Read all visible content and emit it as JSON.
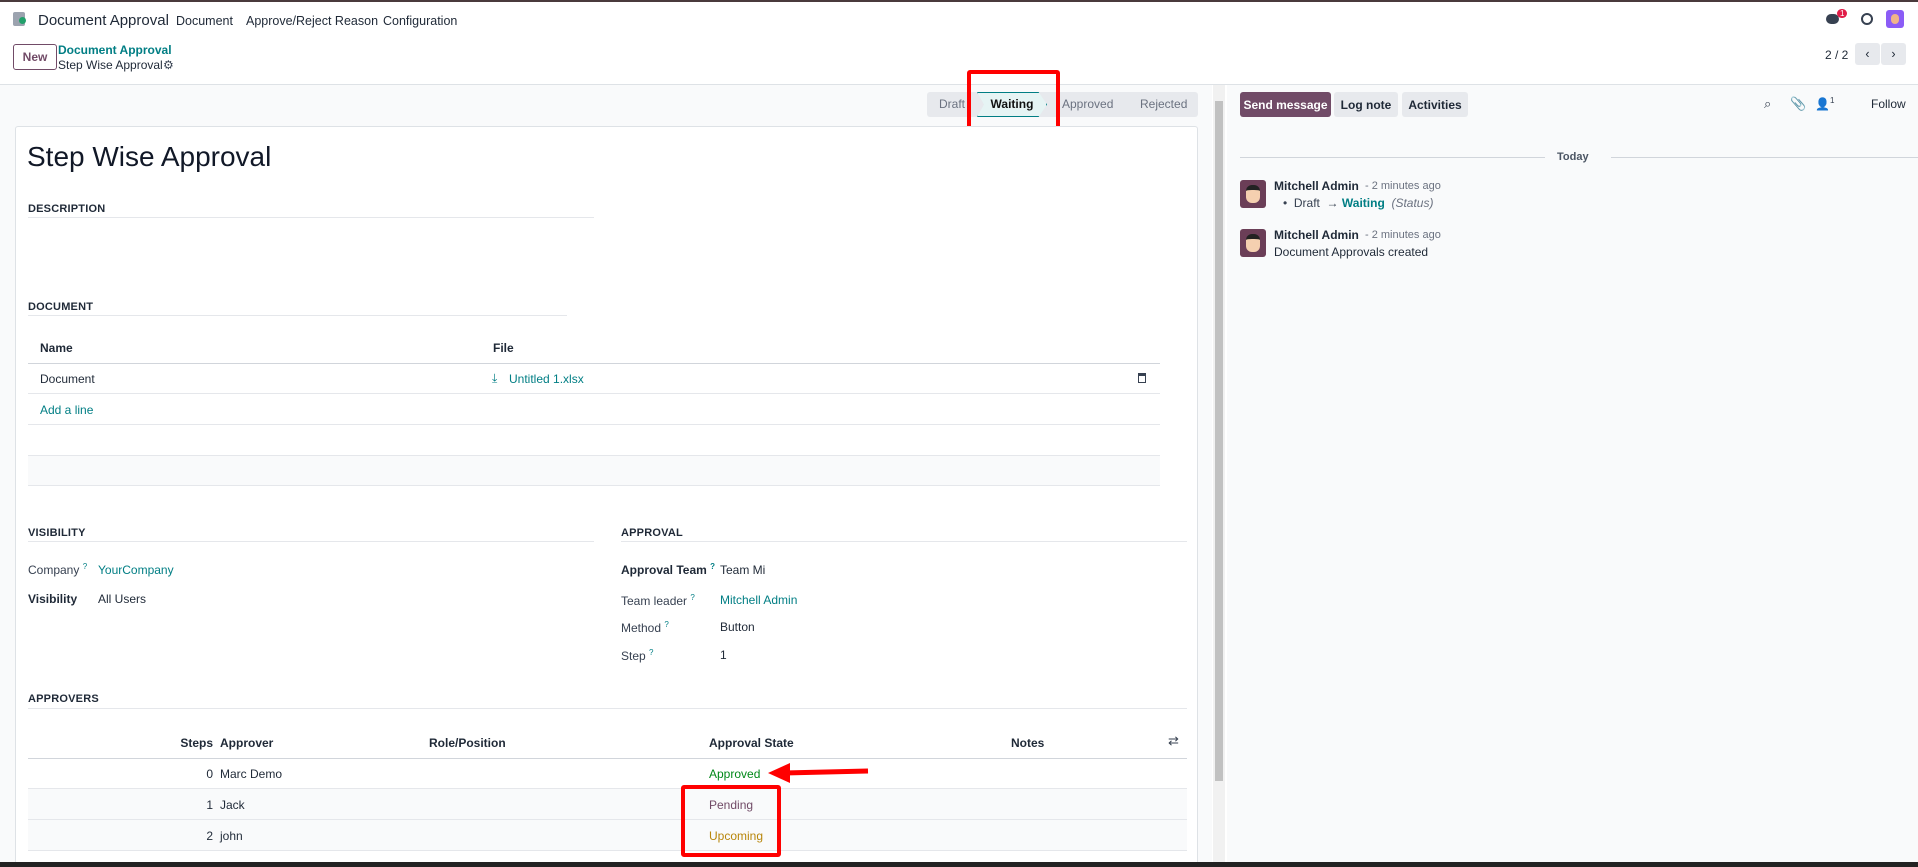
{
  "nav": {
    "app_title": "Document Approval",
    "menu": [
      "Document",
      "Approve/Reject Reason",
      "Configuration"
    ],
    "chat_badge": "1"
  },
  "control": {
    "new_label": "New",
    "breadcrumb_parent": "Document Approval",
    "breadcrumb_current": "Step Wise Approval",
    "pager": "2 / 2"
  },
  "statusbar": {
    "stages": [
      "Draft",
      "Waiting",
      "Approved",
      "Rejected"
    ],
    "active": "Waiting"
  },
  "form": {
    "title": "Step Wise Approval",
    "description_label": "DESCRIPTION",
    "document_label": "DOCUMENT",
    "doc_table": {
      "headers": [
        "Name",
        "File"
      ],
      "rows": [
        {
          "name": "Document",
          "file": "Untitled 1.xlsx"
        }
      ],
      "add_line": "Add a line"
    },
    "visibility_label": "VISIBILITY",
    "company_label": "Company",
    "company_value": "YourCompany",
    "visibility_field_label": "Visibility",
    "visibility_value": "All Users",
    "approval_label": "APPROVAL",
    "approval_team_label": "Approval Team",
    "approval_team_value": "Team Mi",
    "team_leader_label": "Team leader",
    "team_leader_value": "Mitchell Admin",
    "method_label": "Method",
    "method_value": "Button",
    "step_label": "Step",
    "step_value": "1",
    "approvers_label": "APPROVERS",
    "approvers_table": {
      "headers": [
        "Steps",
        "Approver",
        "Role/Position",
        "Approval State",
        "Notes"
      ],
      "rows": [
        {
          "step": "0",
          "approver": "Marc Demo",
          "state": "Approved",
          "color": "#008818"
        },
        {
          "step": "1",
          "approver": "Jack",
          "state": "Pending",
          "color": "#714b67"
        },
        {
          "step": "2",
          "approver": "john",
          "state": "Upcoming",
          "color": "#b8860b"
        }
      ]
    }
  },
  "chatter": {
    "send_message": "Send message",
    "log_note": "Log note",
    "activities": "Activities",
    "followers_count": "1",
    "follow": "Follow",
    "date_sep": "Today",
    "messages": [
      {
        "author": "Mitchell Admin",
        "time": "- 2 minutes ago",
        "from": "Draft",
        "to": "Waiting",
        "field": "(Status)"
      },
      {
        "author": "Mitchell Admin",
        "time": "- 2 minutes ago",
        "body": "Document Approvals created"
      }
    ]
  },
  "colors": {
    "brand": "#714b67",
    "link": "#017e84",
    "annotation": "#ff0000"
  }
}
